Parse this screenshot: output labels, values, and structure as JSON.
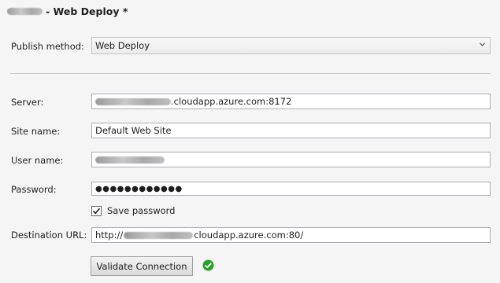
{
  "header": {
    "title_suffix": "- Web Deploy *"
  },
  "publish_method": {
    "label": "Publish method:",
    "value": "Web Deploy"
  },
  "server": {
    "label": "Server:",
    "value_visible": ".cloudapp.azure.com:8172"
  },
  "site_name": {
    "label": "Site name:",
    "value": "Default Web Site"
  },
  "user_name": {
    "label": "User name:"
  },
  "password": {
    "label": "Password:",
    "value": "●●●●●●●●●●●●"
  },
  "save_password": {
    "label": "Save password",
    "checked": true
  },
  "destination_url": {
    "label": "Destination URL:",
    "prefix": "http://",
    "suffix": "cloudapp.azure.com:80/"
  },
  "validate": {
    "label": "Validate Connection"
  },
  "icons": {
    "dropdown": "chevron-down-icon",
    "status": "check-circle-icon",
    "checkbox": "check-icon"
  },
  "colors": {
    "success": "#2e9e2e"
  }
}
